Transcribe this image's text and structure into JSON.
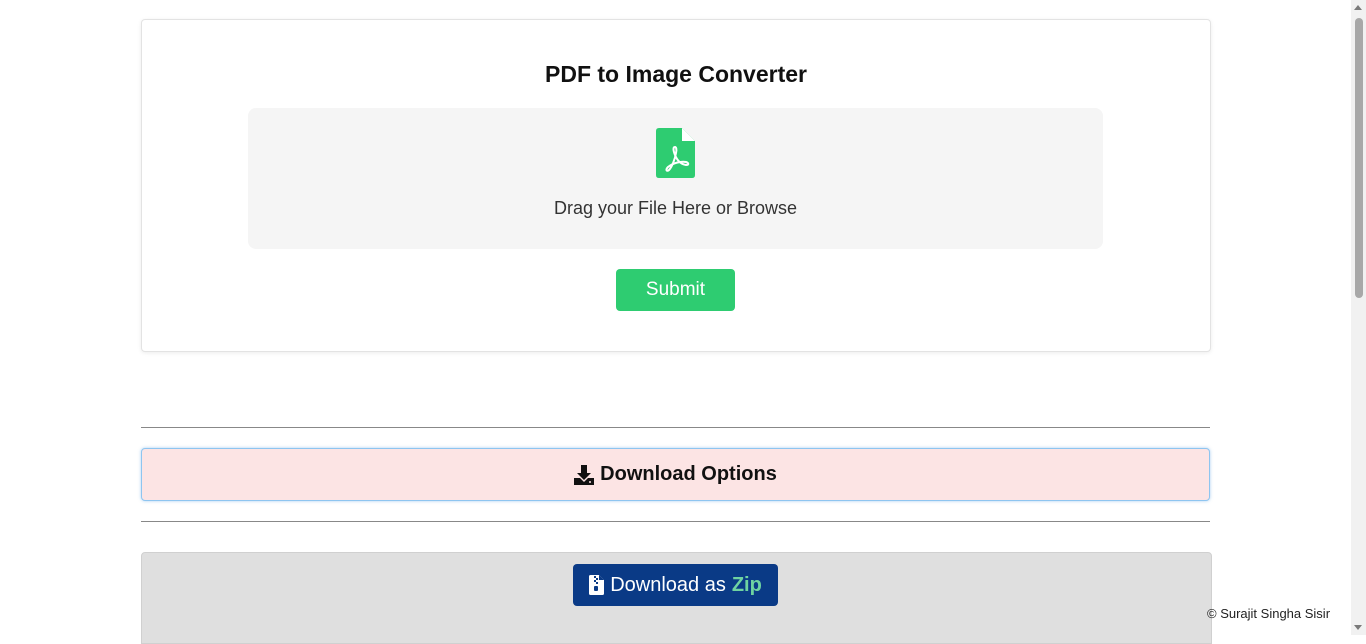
{
  "converter": {
    "title": "PDF to Image Converter",
    "dropzone_text": "Drag your File Here or Browse",
    "dropzone_icon": "pdf-file-icon",
    "submit_label": "Submit"
  },
  "download_options": {
    "label": "Download Options",
    "icon": "download-icon"
  },
  "zip": {
    "label_prefix": "Download as",
    "label_accent": "Zip",
    "icon": "zip-file-icon"
  },
  "footer": {
    "copyright": "© Surajit Singha Sisir"
  },
  "colors": {
    "accent_green": "#2ecc71",
    "zip_button": "#0a3a86",
    "download_options_bg": "#fce4e4"
  }
}
